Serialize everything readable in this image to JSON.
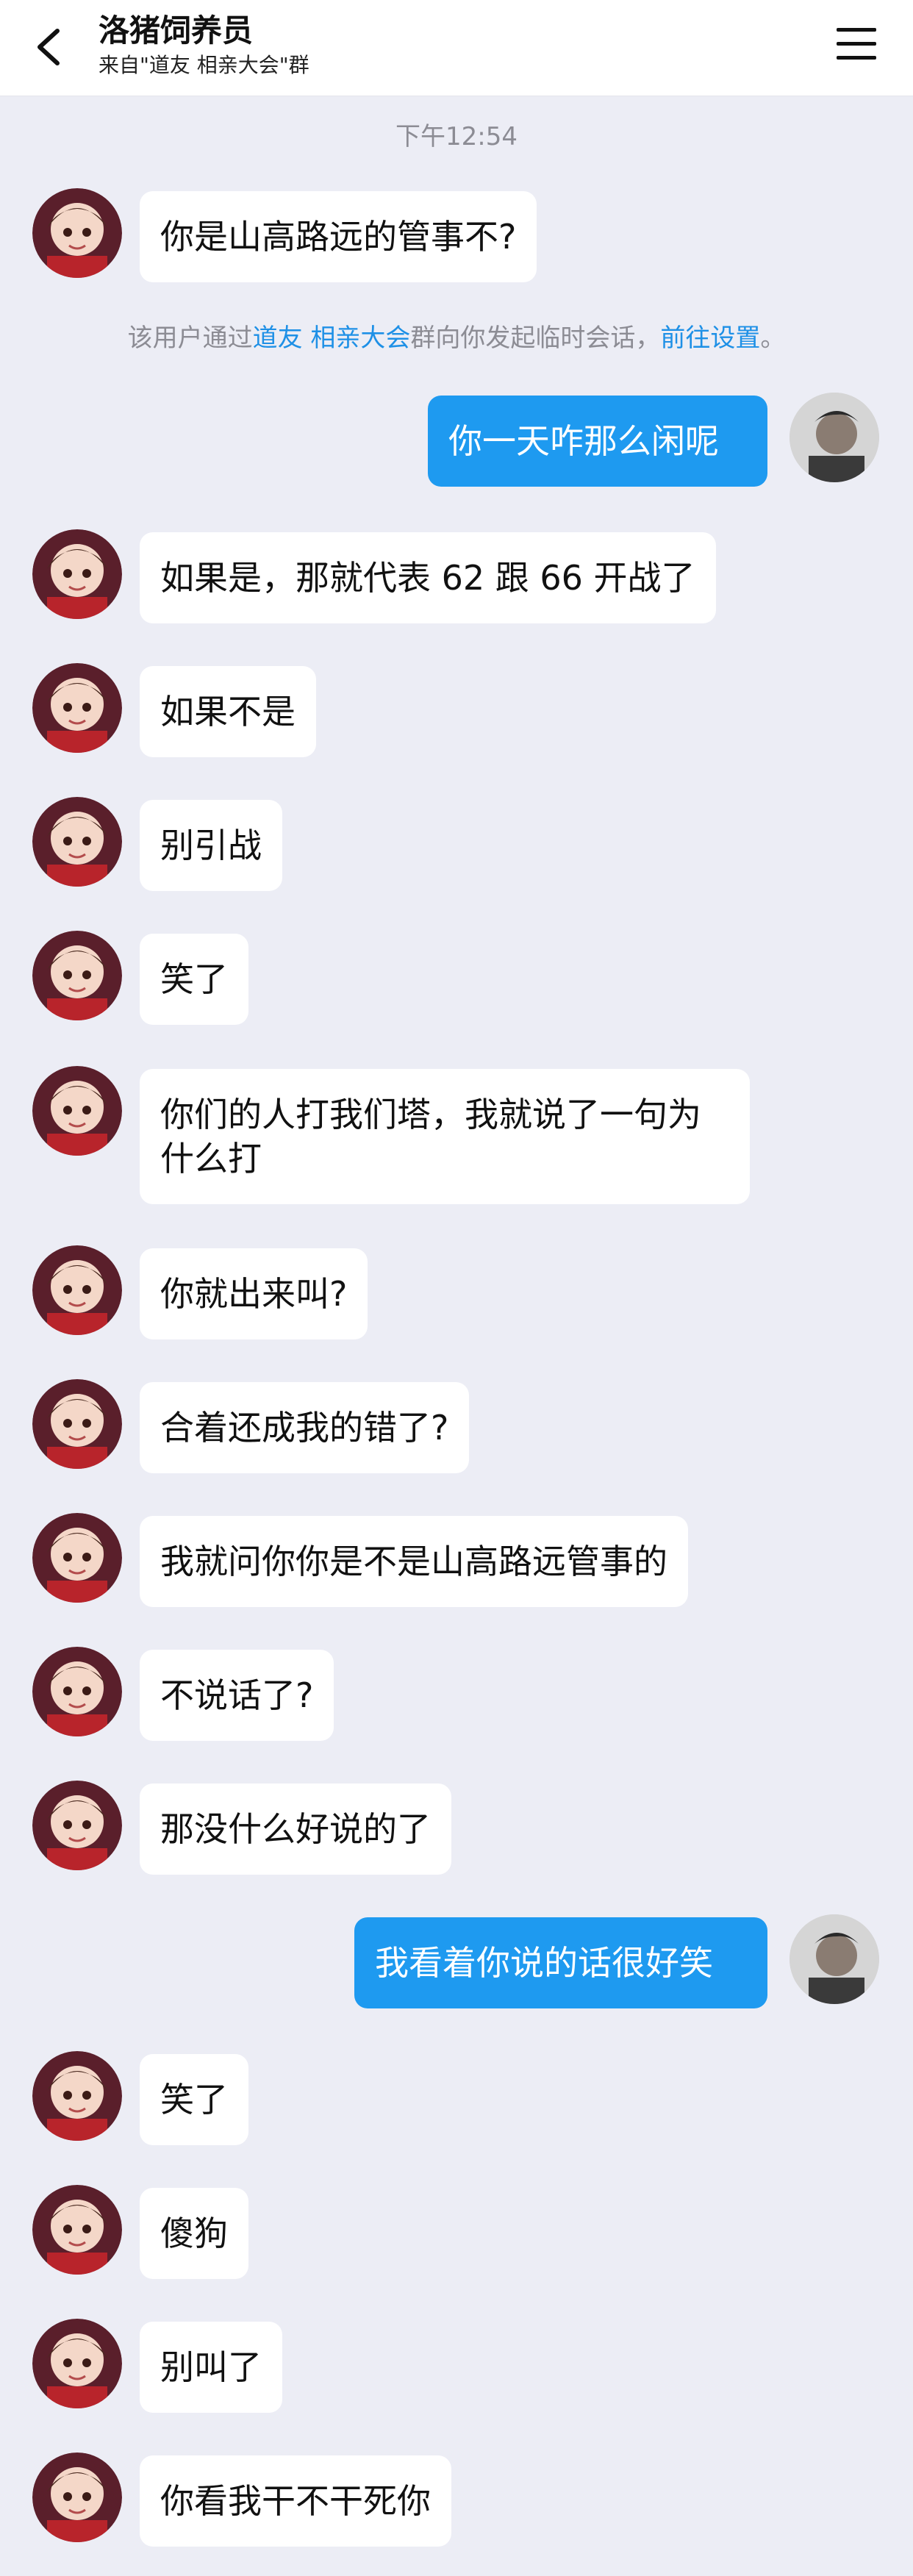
{
  "header": {
    "title": "洛猪饲养员",
    "subtitle": "来自\"道友 相亲大会\"群"
  },
  "chat": {
    "timestamp": "下午12:54",
    "notice": {
      "prefix": "该用户通过",
      "group_link": "道友 相亲大会",
      "middle": "群向你发起临时会话，",
      "settings_link": "前往设置",
      "suffix": "。"
    },
    "messages": [
      {
        "side": "left",
        "text": "你是山高路远的管事不?"
      },
      {
        "side": "right",
        "text": "你一天咋那么闲呢"
      },
      {
        "side": "left",
        "text": "如果是，那就代表 62 跟 66 开战了"
      },
      {
        "side": "left",
        "text": "如果不是"
      },
      {
        "side": "left",
        "text": "别引战"
      },
      {
        "side": "left",
        "text": "笑了"
      },
      {
        "side": "left",
        "text": "你们的人打我们塔，我就说了一句为什么打"
      },
      {
        "side": "left",
        "text": "你就出来叫?"
      },
      {
        "side": "left",
        "text": "合着还成我的错了?"
      },
      {
        "side": "left",
        "text": "我就问你你是不是山高路远管事的"
      },
      {
        "side": "left",
        "text": "不说话了?"
      },
      {
        "side": "left",
        "text": "那没什么好说的了"
      },
      {
        "side": "right",
        "text": "我看着你说的话很好笑"
      },
      {
        "side": "left",
        "text": "笑了"
      },
      {
        "side": "left",
        "text": "傻狗"
      },
      {
        "side": "left",
        "text": "别叫了"
      },
      {
        "side": "left",
        "text": "你看我干不干死你"
      }
    ]
  },
  "colors": {
    "accent": "#1E9AF0",
    "link": "#1E90E6",
    "background": "#ECEDF5"
  },
  "icons": {
    "back": "chevron-left-icon",
    "menu": "menu-icon"
  }
}
